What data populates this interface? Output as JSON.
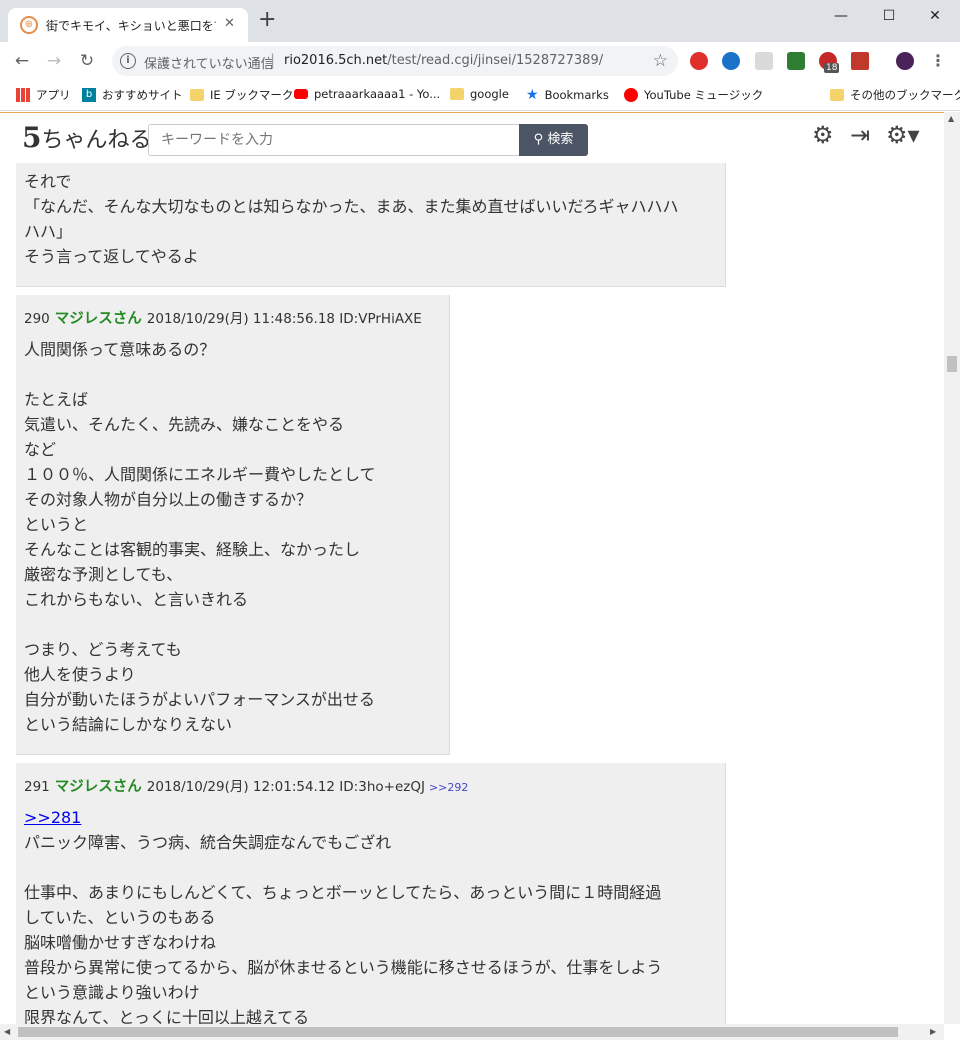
{
  "browser": {
    "tab_title": "街でキモイ、キショいと悪口を言われる",
    "tab_favicon": "⊕",
    "new_tab": "+",
    "security_text": "保護されていない通信",
    "url_host": "rio2016.5ch.net",
    "url_path": "/test/read.cgi/jinsei/1528727389/",
    "extension_badge": "18",
    "bookmarks": [
      {
        "label": "アプリ",
        "icon": "apps-grid-icon"
      },
      {
        "label": "おすすめサイト",
        "icon": "bing-icon"
      },
      {
        "label": "IE ブックマーク",
        "icon": "folder-icon"
      },
      {
        "label": "petraaarkaaaa1 - Yo...",
        "icon": "youtube-icon"
      },
      {
        "label": "google",
        "icon": "folder-icon"
      },
      {
        "label": "Bookmarks",
        "icon": "star-icon"
      },
      {
        "label": "YouTube ミュージック",
        "icon": "youtube-music-icon"
      },
      {
        "label": "その他のブックマーク",
        "icon": "folder-icon"
      }
    ]
  },
  "site": {
    "logo_num": "5",
    "logo_text": "ちゃんねる",
    "search_placeholder": "キーワードを入力",
    "search_button": "検索"
  },
  "posts": [
    {
      "body": "それで\n「なんだ、そんな大切なものとは知らなかった、まあ、また集め直せばいいだろギャハハハ\nハハ」\nそう言って返してやるよ"
    },
    {
      "num": "290",
      "name": "マジレスさん",
      "date": "2018/10/29(月) 11:48:56.18 ID:VPrHiAXE",
      "body": "人間関係って意味あるの？\n\nたとえば\n気遣い、そんたく、先読み、嫌なことをやる\nなど\n１００％、人間関係にエネルギー費やしたとして\nその対象人物が自分以上の働きするか？\nというと\nそんなことは客観的事実、経験上、なかったし\n厳密な予測としても、\nこれからもない、と言いきれる\n\nつまり、どう考えても\n他人を使うより\n自分が動いたほうがよいパフォーマンスが出せる\nという結論にしかなりえない"
    },
    {
      "num": "291",
      "name": "マジレスさん",
      "date": "2018/10/29(月) 12:01:54.12 ID:3ho+ezQJ",
      "reply": ">>292",
      "anchor": ">>281",
      "body": "パニック障害、うつ病、統合失調症なんでもござれ\n\n仕事中、あまりにもしんどくて、ちょっとボーッとしてたら、あっという間に１時間経過\nしていた、というのもある\n脳味噌働かせすぎなわけね\n普段から異常に使ってるから、脳が休ませるという機能に移させるほうが、仕事をしよう\nという意識より強いわけ\n限界なんて、とっくに十回以上越えてる"
    }
  ]
}
